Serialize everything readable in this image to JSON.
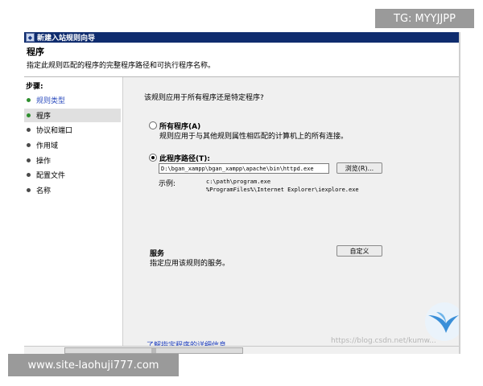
{
  "window": {
    "title": "新建入站规则向导"
  },
  "header": {
    "title": "程序",
    "subtitle": "指定此规则匹配的程序的完整程序路径和可执行程序名称。"
  },
  "steps": {
    "title": "步骤:",
    "items": [
      {
        "label": "规则类型"
      },
      {
        "label": "程序"
      },
      {
        "label": "协议和端口"
      },
      {
        "label": "作用域"
      },
      {
        "label": "操作"
      },
      {
        "label": "配置文件"
      },
      {
        "label": "名称"
      }
    ]
  },
  "content": {
    "question": "该规则应用于所有程序还是特定程序?",
    "all_programs": {
      "label": "所有程序(A)",
      "description": "规则应用于与其他规则属性相匹配的计算机上的所有连接。",
      "checked": false
    },
    "program_path": {
      "label": "此程序路径(T):",
      "value": "D:\\bgan_xampp\\bgan_xampp\\apache\\bin\\httpd.exe",
      "checked": true
    },
    "browse_label": "浏览(R)...",
    "example_label": "示例:",
    "example_1": "c:\\path\\program.exe",
    "example_2": "%ProgramFiles%\\Internet Explorer\\iexplore.exe",
    "services": {
      "title": "服务",
      "description": "指定应用该规则的服务。",
      "customize_label": "自定义"
    },
    "learn_more": "了解指定程序的详细信息"
  },
  "overlays": {
    "tg_badge": "TG: MYYJJPP",
    "site_badge": "www.site-laohuji777.com",
    "watermark": "https://blog.csdn.net/kumw..."
  },
  "colors": {
    "titlebar": "#0f2c6e",
    "link": "#1f3fbf",
    "active_step": "#2f8f2f"
  }
}
